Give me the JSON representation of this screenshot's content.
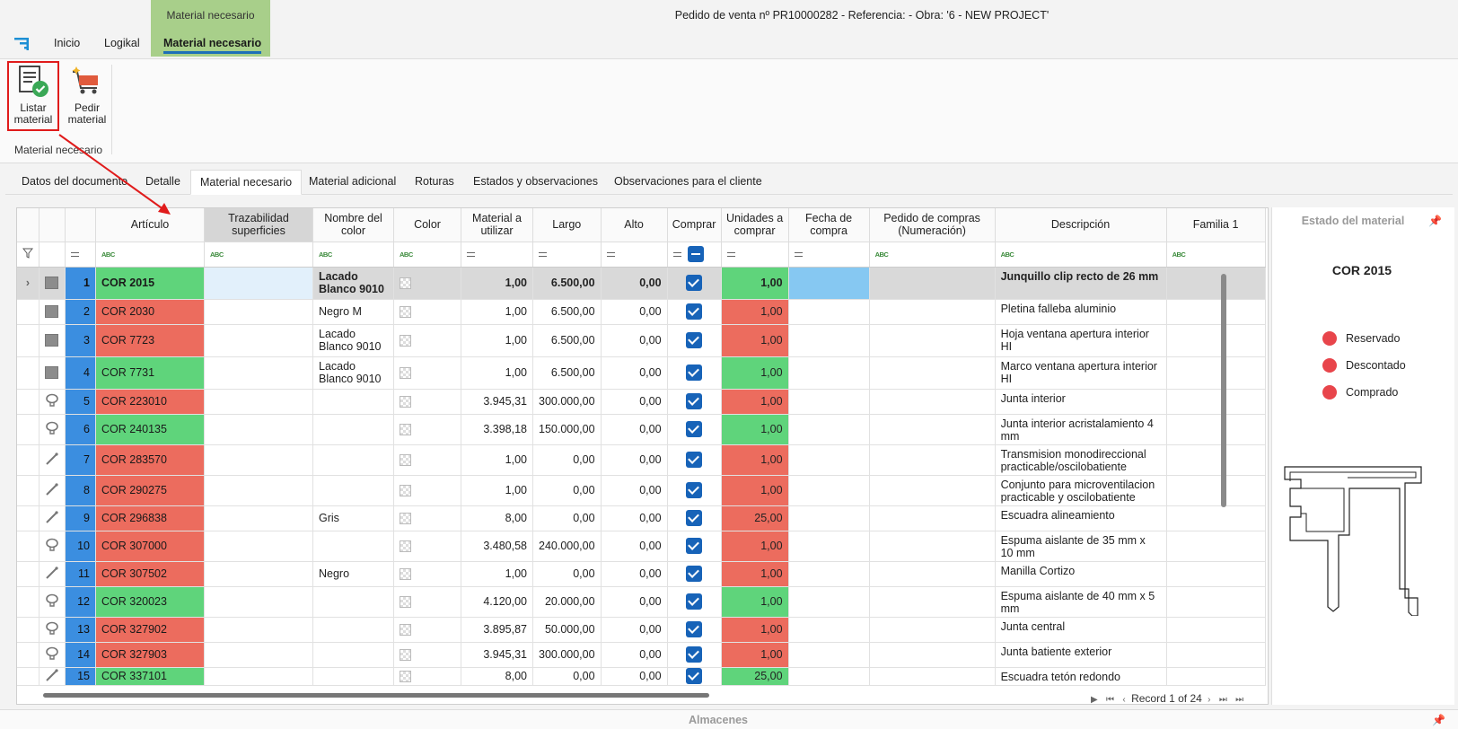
{
  "window": {
    "document_title": "Pedido de venta nº PR10000282 - Referencia:  - Obra: '6 - NEW PROJECT'",
    "context_tab_label": "Material necesario"
  },
  "ribbon_tabs": [
    {
      "label": "Inicio"
    },
    {
      "label": "Logikal"
    },
    {
      "label": "Material necesario",
      "active": true
    }
  ],
  "ribbon": {
    "buttons": [
      {
        "label_line1": "Listar",
        "label_line2": "material",
        "icon": "list-check-icon",
        "highlighted": true
      },
      {
        "label_line1": "Pedir",
        "label_line2": "material",
        "icon": "cart-icon"
      }
    ],
    "group_label": "Material necesario"
  },
  "doc_tabs": [
    {
      "label": "Datos del documento"
    },
    {
      "label": "Detalle"
    },
    {
      "label": "Material necesario",
      "active": true
    },
    {
      "label": "Material adicional"
    },
    {
      "label": "Roturas"
    },
    {
      "label": "Estados y observaciones"
    },
    {
      "label": "Observaciones para el cliente"
    }
  ],
  "grid": {
    "columns": [
      {
        "key": "articulo",
        "label": "Artículo"
      },
      {
        "key": "trazabilidad",
        "label": "Trazabilidad superficies"
      },
      {
        "key": "nombre_color",
        "label": "Nombre del color"
      },
      {
        "key": "color",
        "label": "Color"
      },
      {
        "key": "material",
        "label": "Material a utilizar"
      },
      {
        "key": "largo",
        "label": "Largo"
      },
      {
        "key": "alto",
        "label": "Alto"
      },
      {
        "key": "comprar",
        "label": "Comprar"
      },
      {
        "key": "unidades",
        "label": "Unidades a comprar"
      },
      {
        "key": "fecha",
        "label": "Fecha de compra"
      },
      {
        "key": "pedido",
        "label": "Pedido de compras (Numeración)"
      },
      {
        "key": "descripcion",
        "label": "Descripción"
      },
      {
        "key": "familia",
        "label": "Familia 1"
      }
    ],
    "filter_abc": "ABC",
    "rows": [
      {
        "n": "1",
        "icon": "square",
        "articulo": "COR 2015",
        "status": "green",
        "color_name": "Lacado Blanco 9010",
        "material": "1,00",
        "largo": "6.500,00",
        "alto": "0,00",
        "unidades": "1,00",
        "descripcion": "Junquillo clip recto de 26 mm",
        "selected": true
      },
      {
        "n": "2",
        "icon": "square",
        "articulo": "COR 2030",
        "status": "red",
        "color_name": "Negro M",
        "material": "1,00",
        "largo": "6.500,00",
        "alto": "0,00",
        "unidades": "1,00",
        "descripcion": "Pletina falleba aluminio"
      },
      {
        "n": "3",
        "icon": "square",
        "articulo": "COR 7723",
        "status": "red",
        "color_name": "Lacado Blanco 9010",
        "material": "1,00",
        "largo": "6.500,00",
        "alto": "0,00",
        "unidades": "1,00",
        "descripcion": "Hoja ventana apertura interior HI"
      },
      {
        "n": "4",
        "icon": "square",
        "articulo": "COR 7731",
        "status": "green",
        "color_name": "Lacado Blanco 9010",
        "material": "1,00",
        "largo": "6.500,00",
        "alto": "0,00",
        "unidades": "1,00",
        "descripcion": "Marco ventana apertura interior HI"
      },
      {
        "n": "5",
        "icon": "gasket",
        "articulo": "COR 223010",
        "status": "red",
        "color_name": "",
        "material": "3.945,31",
        "largo": "300.000,00",
        "alto": "0,00",
        "unidades": "1,00",
        "descripcion": "Junta interior"
      },
      {
        "n": "6",
        "icon": "gasket",
        "articulo": "COR 240135",
        "status": "green",
        "color_name": "",
        "material": "3.398,18",
        "largo": "150.000,00",
        "alto": "0,00",
        "unidades": "1,00",
        "descripcion": "Junta interior acristalamiento 4 mm"
      },
      {
        "n": "7",
        "icon": "tool",
        "articulo": "COR 283570",
        "status": "red",
        "color_name": "",
        "material": "1,00",
        "largo": "0,00",
        "alto": "0,00",
        "unidades": "1,00",
        "descripcion": "Transmision monodireccional practicable/oscilobatiente"
      },
      {
        "n": "8",
        "icon": "tool",
        "articulo": "COR 290275",
        "status": "red",
        "color_name": "",
        "material": "1,00",
        "largo": "0,00",
        "alto": "0,00",
        "unidades": "1,00",
        "descripcion": "Conjunto para microventilacion practicable y oscilobatiente"
      },
      {
        "n": "9",
        "icon": "tool",
        "articulo": "COR 296838",
        "status": "red",
        "color_name": "Gris",
        "material": "8,00",
        "largo": "0,00",
        "alto": "0,00",
        "unidades": "25,00",
        "descripcion": "Escuadra alineamiento"
      },
      {
        "n": "10",
        "icon": "gasket",
        "articulo": "COR 307000",
        "status": "red",
        "color_name": "",
        "material": "3.480,58",
        "largo": "240.000,00",
        "alto": "0,00",
        "unidades": "1,00",
        "descripcion": "Espuma aislante de 35 mm x 10 mm"
      },
      {
        "n": "11",
        "icon": "tool",
        "articulo": "COR 307502",
        "status": "red",
        "color_name": "Negro",
        "material": "1,00",
        "largo": "0,00",
        "alto": "0,00",
        "unidades": "1,00",
        "descripcion": "Manilla Cortizo"
      },
      {
        "n": "12",
        "icon": "gasket",
        "articulo": "COR 320023",
        "status": "green",
        "color_name": "",
        "material": "4.120,00",
        "largo": "20.000,00",
        "alto": "0,00",
        "unidades": "1,00",
        "descripcion": "Espuma aislante de 40 mm x 5 mm"
      },
      {
        "n": "13",
        "icon": "gasket",
        "articulo": "COR 327902",
        "status": "red",
        "color_name": "",
        "material": "3.895,87",
        "largo": "50.000,00",
        "alto": "0,00",
        "unidades": "1,00",
        "descripcion": "Junta central"
      },
      {
        "n": "14",
        "icon": "gasket",
        "articulo": "COR 327903",
        "status": "red",
        "color_name": "",
        "material": "3.945,31",
        "largo": "300.000,00",
        "alto": "0,00",
        "unidades": "1,00",
        "descripcion": "Junta batiente exterior"
      },
      {
        "n": "15",
        "icon": "tool",
        "articulo": "COR 337101",
        "status": "green",
        "color_name": "",
        "material": "8,00",
        "largo": "0,00",
        "alto": "0,00",
        "unidades": "25,00",
        "descripcion": "Escuadra tetón redondo"
      }
    ]
  },
  "pager": {
    "record_text": "Record 1 of 24"
  },
  "side_panel": {
    "title": "Estado del material",
    "article_code": "COR 2015",
    "legend": [
      {
        "label": "Reservado",
        "color": "#e8454b"
      },
      {
        "label": "Descontado",
        "color": "#e8454b"
      },
      {
        "label": "Comprado",
        "color": "#e8454b"
      }
    ]
  },
  "bottom_panel": {
    "title": "Almacenes"
  },
  "colors": {
    "accent": "#1d6fb8",
    "index_blue": "#3b8ee0",
    "status_red": "#ec6c5e",
    "status_green": "#5fd47b",
    "ribbon_context": "#a8cf8a",
    "highlight": "#e01b1b"
  }
}
